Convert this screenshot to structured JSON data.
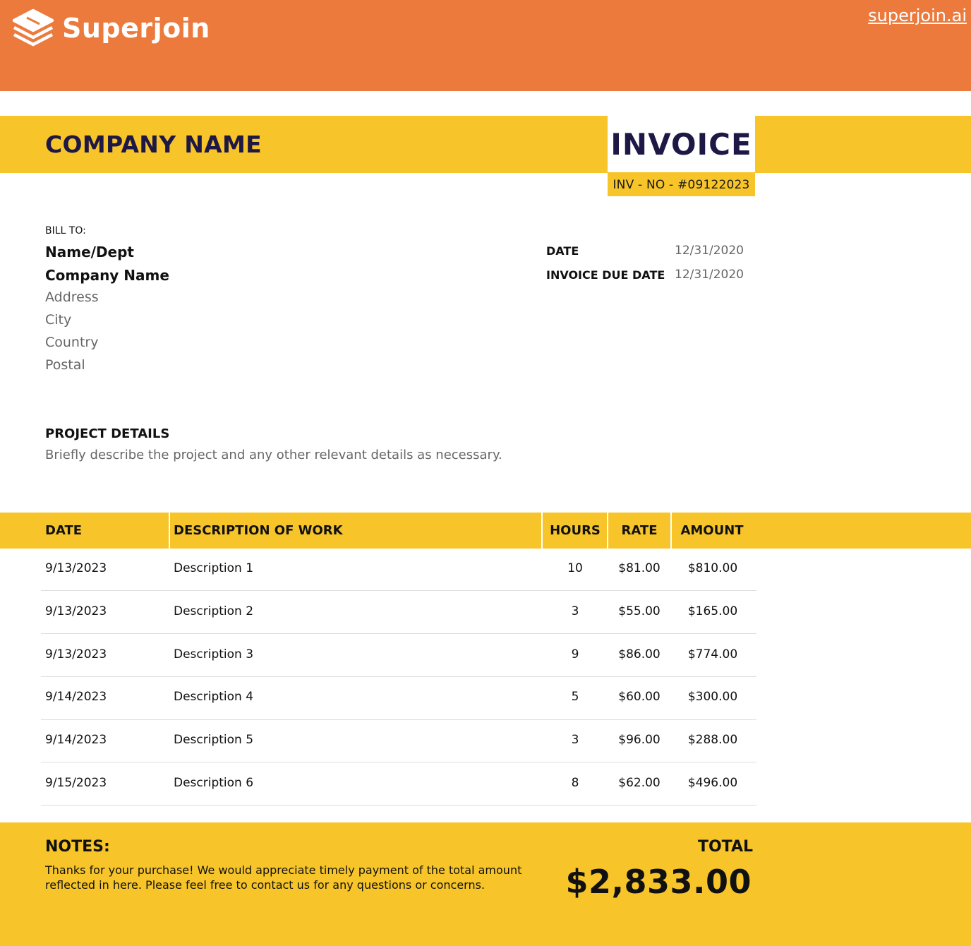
{
  "header": {
    "brand": "Superjoin",
    "site_link": "superjoin.ai",
    "brand_color": "#ec7a3d",
    "accent_color": "#f7c52a"
  },
  "title": {
    "company_name": "COMPANY NAME",
    "invoice_label": "INVOICE",
    "invoice_number": "INV - NO - #09122023"
  },
  "bill_to": {
    "label": "BILL TO:",
    "name": "Name/Dept",
    "company": "Company Name",
    "address": "Address",
    "city": "City",
    "country": "Country",
    "postal": "Postal"
  },
  "dates": {
    "date_label": "DATE",
    "date_value": "12/31/2020",
    "due_label": "INVOICE DUE DATE",
    "due_value": "12/31/2020"
  },
  "project": {
    "title": "PROJECT DETAILS",
    "description": "Briefly describe the project and any other relevant details as necessary."
  },
  "table": {
    "headers": {
      "date": "DATE",
      "description": "DESCRIPTION OF WORK",
      "hours": "HOURS",
      "rate": "RATE",
      "amount": "AMOUNT"
    },
    "rows": [
      {
        "date": "9/13/2023",
        "description": "Description 1",
        "hours": "10",
        "rate": "$81.00",
        "amount": "$810.00"
      },
      {
        "date": "9/13/2023",
        "description": "Description 2",
        "hours": "3",
        "rate": "$55.00",
        "amount": "$165.00"
      },
      {
        "date": "9/13/2023",
        "description": "Description 3",
        "hours": "9",
        "rate": "$86.00",
        "amount": "$774.00"
      },
      {
        "date": "9/14/2023",
        "description": "Description 4",
        "hours": "5",
        "rate": "$60.00",
        "amount": "$300.00"
      },
      {
        "date": "9/14/2023",
        "description": "Description 5",
        "hours": "3",
        "rate": "$96.00",
        "amount": "$288.00"
      },
      {
        "date": "9/15/2023",
        "description": "Description 6",
        "hours": "8",
        "rate": "$62.00",
        "amount": "$496.00"
      }
    ]
  },
  "footer": {
    "notes_title": "NOTES:",
    "notes_text": "Thanks for your purchase! We would appreciate timely payment of the total amount reflected in here. Please feel free to contact us for any questions or concerns.",
    "total_label": "TOTAL",
    "total_value": "$2,833.00"
  }
}
